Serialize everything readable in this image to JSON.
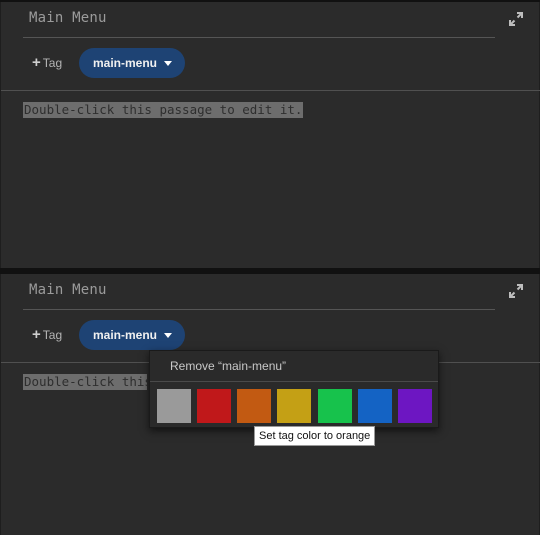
{
  "panels": [
    {
      "title": "Main Menu",
      "add_tag_label": "Tag",
      "tag": {
        "label": "main-menu"
      },
      "passage_text": "Double-click this passage to edit it."
    },
    {
      "title": "Main Menu",
      "add_tag_label": "Tag",
      "tag": {
        "label": "main-menu"
      },
      "passage_text": "Double-click this passage to edit it.",
      "dropdown": {
        "remove_label": "Remove “main-menu”",
        "swatches": [
          {
            "name": "gray",
            "color": "#9a9a9a"
          },
          {
            "name": "red",
            "color": "#c0181a"
          },
          {
            "name": "orange",
            "color": "#c25a12"
          },
          {
            "name": "yellow",
            "color": "#c4a015"
          },
          {
            "name": "green",
            "color": "#17c24c"
          },
          {
            "name": "blue",
            "color": "#1463c4"
          },
          {
            "name": "purple",
            "color": "#6d16c2"
          }
        ],
        "tooltip": "Set tag color to orange"
      }
    }
  ],
  "colors": {
    "background": "#2b2b2b",
    "tag_pill": "#1e4374"
  },
  "icons": {
    "expand": "expand-arrows-icon",
    "add": "plus-icon",
    "caret": "caret-down-icon"
  }
}
